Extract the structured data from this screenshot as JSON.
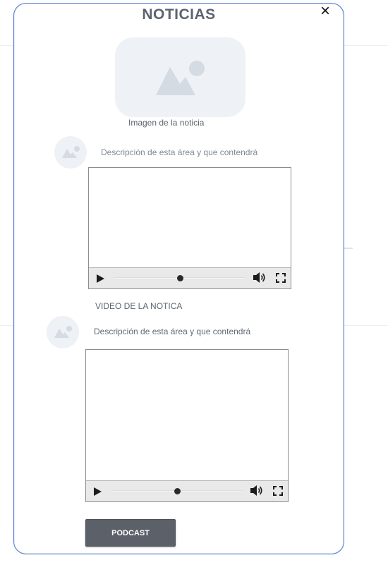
{
  "modal": {
    "title": "NOTICIAS",
    "close_symbol": "×",
    "accent_color": "#4d79d6"
  },
  "news_image": {
    "icon": "image-placeholder-icon",
    "caption": "Imagen de la noticia"
  },
  "sections": [
    {
      "icon": "image-placeholder-icon",
      "description": "Descripción de esta área y que contendrá",
      "video": {
        "progress": 0.5,
        "icons": [
          "play-icon",
          "volume-icon",
          "fullscreen-icon"
        ]
      },
      "video_caption": "VIDEO DE LA NOTICA"
    },
    {
      "icon": "image-placeholder-icon",
      "description": "Descripción de esta área y que contendrá",
      "video": {
        "progress": 0.5,
        "icons": [
          "play-icon",
          "volume-icon",
          "fullscreen-icon"
        ]
      }
    }
  ],
  "podcast_button": {
    "label": "PODCAST"
  }
}
